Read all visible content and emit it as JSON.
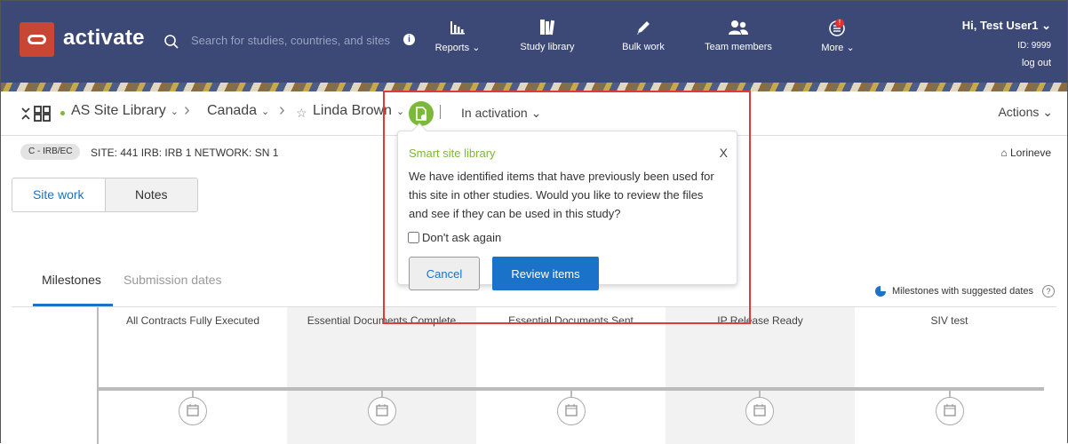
{
  "brand": {
    "name": "activate"
  },
  "search": {
    "placeholder": "Search for studies, countries, and sites"
  },
  "nav": [
    {
      "label": "Reports",
      "icon": "bar-chart-icon",
      "has_dropdown": true
    },
    {
      "label": "Study library",
      "icon": "library-icon",
      "has_dropdown": false
    },
    {
      "label": "Bulk work",
      "icon": "pencil-icon",
      "has_dropdown": false
    },
    {
      "label": "Team members",
      "icon": "users-icon",
      "has_dropdown": false
    },
    {
      "label": "More",
      "icon": "menu-icon",
      "has_dropdown": true,
      "badge": "!"
    }
  ],
  "user": {
    "greeting": "Hi, Test User1",
    "id": "ID: 9999",
    "logout": "log out"
  },
  "breadcrumb": {
    "library": "AS Site Library",
    "country": "Canada",
    "site": "Linda Brown",
    "status": "In activation",
    "actions": "Actions"
  },
  "meta": {
    "chip": "C - IRB/EC",
    "details": "SITE: 441  IRB: IRB 1  NETWORK: SN 1",
    "owner": "Lorineve"
  },
  "segments": {
    "site_work": "Site work",
    "notes": "Notes"
  },
  "tabs": {
    "milestones": "Milestones",
    "submission_dates": "Submission dates"
  },
  "legend": {
    "label": "Milestones with suggested dates",
    "help": "?"
  },
  "milestones": [
    "All Contracts Fully Executed",
    "Essential Documents Complete",
    "Essential Documents Sent",
    "IP Release Ready",
    "SIV test"
  ],
  "popover": {
    "title": "Smart site library",
    "close": "X",
    "body": "We have identified items that have previously been used for this site in other studies. Would you like to review the files and see if they can be used in this study?",
    "checkbox_label": "Don't ask again",
    "cancel": "Cancel",
    "review": "Review items"
  },
  "colors": {
    "header": "#3c4876",
    "brand_red": "#c74634",
    "accent_blue": "#1a73c8",
    "green": "#7cb83a",
    "highlight": "#e03a3a"
  }
}
